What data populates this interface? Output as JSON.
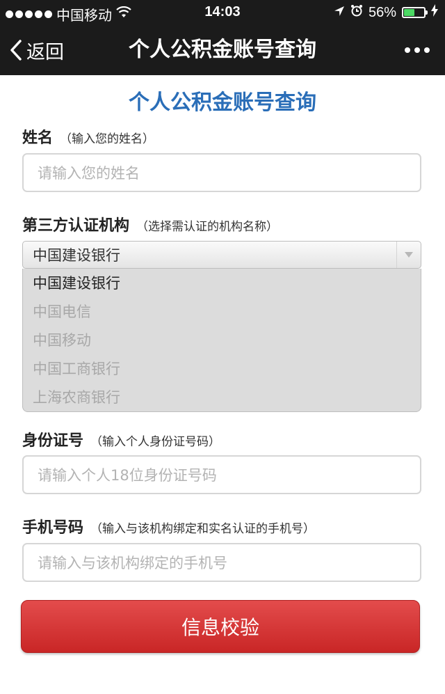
{
  "status_bar": {
    "carrier": "中国移动",
    "time": "14:03",
    "battery": "56%",
    "battery_level": 0.56,
    "icons": [
      "signal-dots-icon",
      "wifi-icon",
      "location-arrow-icon",
      "alarm-icon",
      "battery-icon",
      "charging-bolt-icon"
    ]
  },
  "nav": {
    "back_label": "返回",
    "title": "个人公积金账号查询",
    "more_icon": "more-dots-icon"
  },
  "page": {
    "heading": "个人公积金账号查询"
  },
  "form": {
    "name": {
      "label": "姓名",
      "hint": "（输入您的姓名）",
      "placeholder": "请输入您的姓名"
    },
    "institution": {
      "label": "第三方认证机构",
      "hint": "（选择需认证的机构名称）",
      "selected": "中国建设银行",
      "options": [
        "中国建设银行",
        "中国电信",
        "中国移动",
        "中国工商银行",
        "上海农商银行"
      ]
    },
    "id_number": {
      "label": "身份证号",
      "hint": "（输入个人身份证号码）",
      "placeholder": "请输入个人18位身份证号码"
    },
    "phone": {
      "label": "手机号码",
      "hint": "（输入与该机构绑定和实名认证的手机号）",
      "placeholder": "请输入与该机构绑定的手机号"
    },
    "submit_label": "信息校验"
  },
  "colors": {
    "status_bar_bg": "#1b1b1b",
    "heading_blue": "#2a6eb8",
    "button_red": "#d63a3a",
    "battery_green": "#4cd964"
  }
}
